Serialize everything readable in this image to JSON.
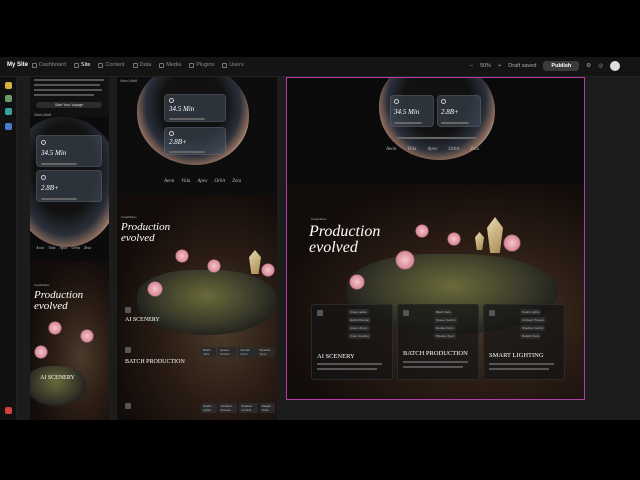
{
  "app": {
    "site_name": "My Site",
    "nav": [
      "Dashboard",
      "Site",
      "Content",
      "Data",
      "Media",
      "Plugins",
      "Users"
    ],
    "active_nav": "Site",
    "zoom": "50%",
    "save_status": "Draft saved",
    "publish_label": "Publish"
  },
  "page": {
    "cta_label": "Start Your Voyage",
    "view_label": "View Liftoff",
    "stat_time": "34.5 Min",
    "stat_count": "2.8B+",
    "brands": [
      "Aeon",
      "Vida",
      "Apex",
      "Orbit",
      "Zeta"
    ],
    "hero_eyebrow": "Capabilities",
    "hero_title_1": "Production",
    "hero_title_2": "evolved",
    "features": [
      {
        "title": "AI SCENERY",
        "tags": [
          "Cloud-native",
          "Hybrid Render",
          "Asset Library",
          "Color Grading"
        ]
      },
      {
        "title": "BATCH PRODUCTION",
        "tags": [
          "Batch Jobs",
          "Queue Control",
          "Render Farm",
          "Pipeline Sync"
        ]
      },
      {
        "title": "SMART LIGHTING",
        "tags": [
          "Studio Lights",
          "Ambient Presets",
          "Shadow Control",
          "Relight Tools"
        ]
      }
    ]
  }
}
